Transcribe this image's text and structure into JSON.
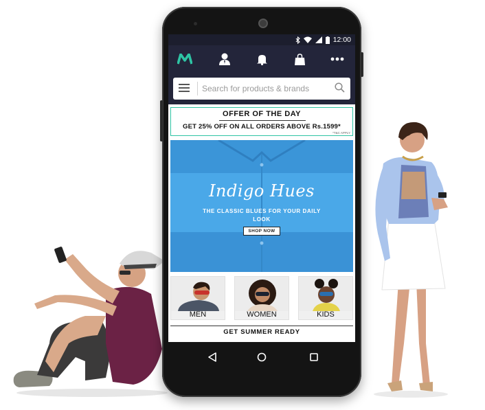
{
  "status_bar": {
    "time": "12:00"
  },
  "app_bar": {
    "logo_letter": "M",
    "icons": [
      "profile-icon",
      "bell-icon",
      "shopping-bag-icon",
      "more-icon"
    ]
  },
  "search": {
    "placeholder": "Search for products & brands"
  },
  "offer": {
    "title": "OFFER OF THE DAY",
    "subtitle": "GET 25% OFF ON ALL ORDERS ABOVE Rs.1599*",
    "terms": "*T&C APPLY"
  },
  "banner": {
    "title": "Indigo Hues",
    "subtitle": "THE CLASSIC BLUES FOR YOUR DAILY LOOK",
    "cta": "SHOP NOW"
  },
  "categories": [
    {
      "label": "MEN"
    },
    {
      "label": "WOMEN"
    },
    {
      "label": "KIDS"
    }
  ],
  "section_heading": "GET SUMMER READY",
  "colors": {
    "app_bar": "#23253a",
    "logo": "#2ec4a4",
    "banner": "#3f9ee0"
  }
}
